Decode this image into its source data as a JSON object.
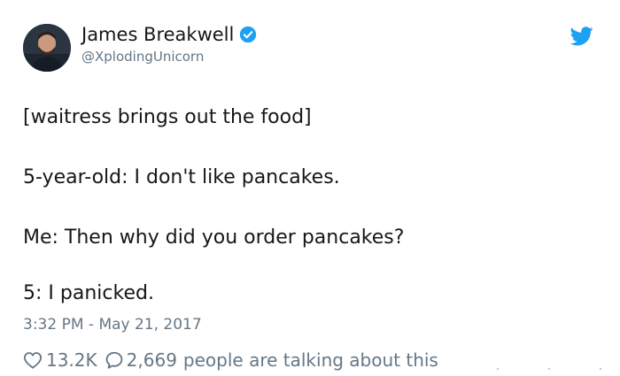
{
  "author": {
    "name": "James Breakwell",
    "handle": "@XplodingUnicorn",
    "verified": true,
    "avatar_icon": "avatar-photo"
  },
  "brand": {
    "icon": "twitter-bird-icon",
    "color": "#1da1f2"
  },
  "tweet": {
    "lines": [
      "[waitress brings out the food]",
      "5-year-old: I don't like pancakes.",
      "Me: Then why did you order pancakes?",
      "5: I panicked."
    ],
    "timestamp": "3:32 PM - May 21, 2017"
  },
  "actions": {
    "likes": "13.2K",
    "replies": "2,669",
    "talking_text": "people are talking about this"
  },
  "colors": {
    "text": "#14171a",
    "secondary": "#657786",
    "verified_badge": "#1da1f2"
  }
}
